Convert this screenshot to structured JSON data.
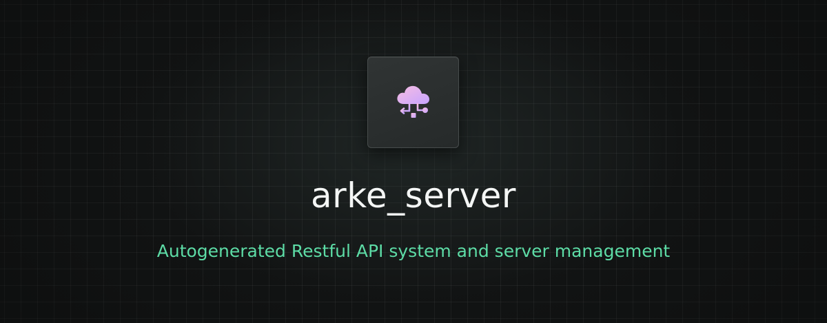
{
  "banner": {
    "title": "arke_server",
    "subtitle": "Autogenerated Restful API system and server management",
    "logo_icon": "cloud-network-icon"
  },
  "colors": {
    "background": "#121414",
    "title": "#f4f6f5",
    "subtitle": "#5ddca6",
    "icon_gradient_start": "#f2b8e4",
    "icon_gradient_end": "#c9a3ff"
  }
}
